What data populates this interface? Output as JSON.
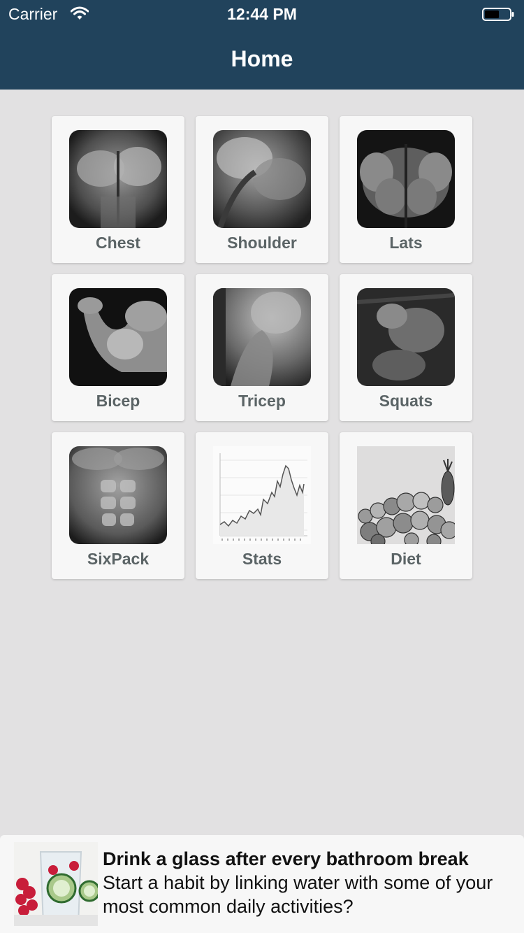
{
  "status_bar": {
    "carrier": "Carrier",
    "time": "12:44 PM"
  },
  "nav": {
    "title": "Home"
  },
  "tiles": [
    {
      "label": "Chest",
      "icon": "chest-photo"
    },
    {
      "label": "Shoulder",
      "icon": "shoulder-photo"
    },
    {
      "label": "Lats",
      "icon": "lats-photo"
    },
    {
      "label": "Bicep",
      "icon": "bicep-photo"
    },
    {
      "label": "Tricep",
      "icon": "tricep-photo"
    },
    {
      "label": "Squats",
      "icon": "squats-photo"
    },
    {
      "label": "SixPack",
      "icon": "sixpack-photo"
    },
    {
      "label": "Stats",
      "icon": "stats-chart"
    },
    {
      "label": "Diet",
      "icon": "diet-photo"
    }
  ],
  "tip": {
    "title": "Drink a glass after every bathroom break",
    "body": "Start a habit by linking water with some of your most common daily activities?"
  },
  "colors": {
    "header": "#21435c",
    "background": "#e2e1e2",
    "tile": "#f7f7f7",
    "tile_label": "#5b6466"
  }
}
